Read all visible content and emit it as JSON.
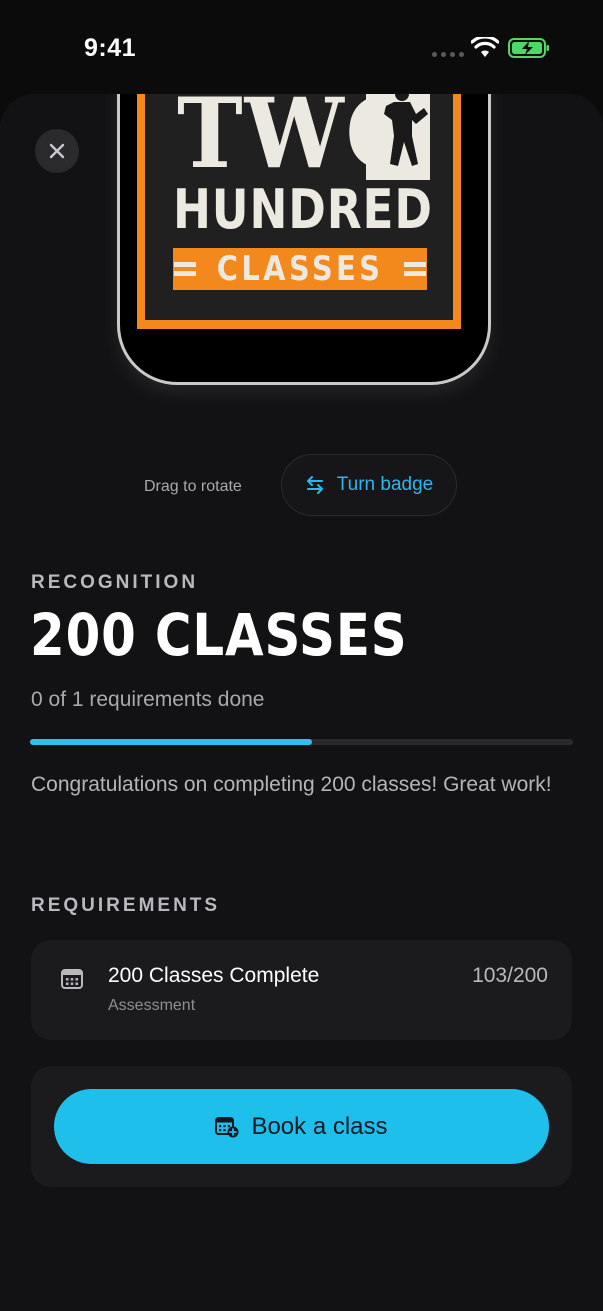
{
  "status_bar": {
    "time": "9:41"
  },
  "badge": {
    "line1": "TWO",
    "line2": "HUNDRED",
    "line3": "CLASSES"
  },
  "rotate": {
    "hint": "Drag to rotate",
    "turn_label": "Turn badge"
  },
  "recognition": {
    "label": "RECOGNITION",
    "title": "200 CLASSES",
    "requirements_done": "0 of 1 requirements done",
    "progress_fraction": 0.52,
    "description": "Congratulations on completing 200 classes! Great work!"
  },
  "requirements": {
    "heading": "REQUIREMENTS",
    "items": [
      {
        "title": "200 Classes Complete",
        "subtitle": "Assessment",
        "count": "103/200"
      }
    ]
  },
  "actions": {
    "book_label": "Book a class"
  },
  "colors": {
    "accent": "#2ec0ec",
    "background": "#121214",
    "badge_orange": "#f3891d"
  }
}
